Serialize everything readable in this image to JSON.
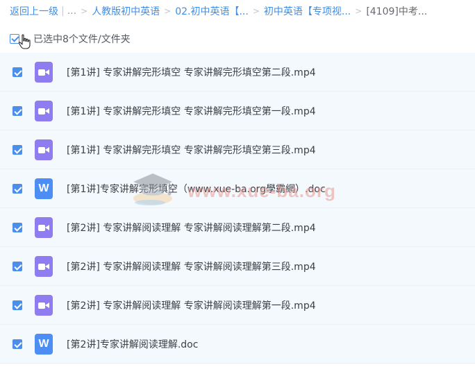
{
  "breadcrumb": {
    "back_label": "返回上一级",
    "bar": "|",
    "ellipsis": "...",
    "sep": ">",
    "items": [
      {
        "label": "人教版初中英语"
      },
      {
        "label": "02.初中英语【..."
      },
      {
        "label": "初中英语【专项视..."
      }
    ],
    "current": "[4109]中考..."
  },
  "selection": {
    "label": "已选中8个文件/文件夹"
  },
  "files": [
    {
      "name": "[第1讲] 专家讲解完形填空 专家讲解完形填空第二段.mp4",
      "type_icon": "video-file-icon",
      "checked": true
    },
    {
      "name": "[第1讲] 专家讲解完形填空 专家讲解完形填空第一段.mp4",
      "type_icon": "video-file-icon",
      "checked": true
    },
    {
      "name": "[第1讲] 专家讲解完形填空 专家讲解完形填空第三段.mp4",
      "type_icon": "video-file-icon",
      "checked": true
    },
    {
      "name": "[第1讲]专家讲解完形填空（www.xue-ba.org學霸網）.doc",
      "type_icon": "word-file-icon",
      "checked": true
    },
    {
      "name": "[第2讲] 专家讲解阅读理解 专家讲解阅读理解第二段.mp4",
      "type_icon": "video-file-icon",
      "checked": true
    },
    {
      "name": "[第2讲] 专家讲解阅读理解 专家讲解阅读理解第三段.mp4",
      "type_icon": "video-file-icon",
      "checked": true
    },
    {
      "name": "[第2讲] 专家讲解阅读理解 专家讲解阅读理解第一段.mp4",
      "type_icon": "video-file-icon",
      "checked": true
    },
    {
      "name": "[第2讲]专家讲解阅读理解.doc",
      "type_icon": "word-file-icon",
      "checked": true
    }
  ],
  "watermark": {
    "text": "www.xue-ba.org"
  },
  "colors": {
    "link": "#3e8ee8",
    "checkbox": "#4d8ee8",
    "row_bg": "#f4f9fe",
    "video_icon": "#8e7cf0",
    "doc_icon": "#4d8ef5"
  }
}
